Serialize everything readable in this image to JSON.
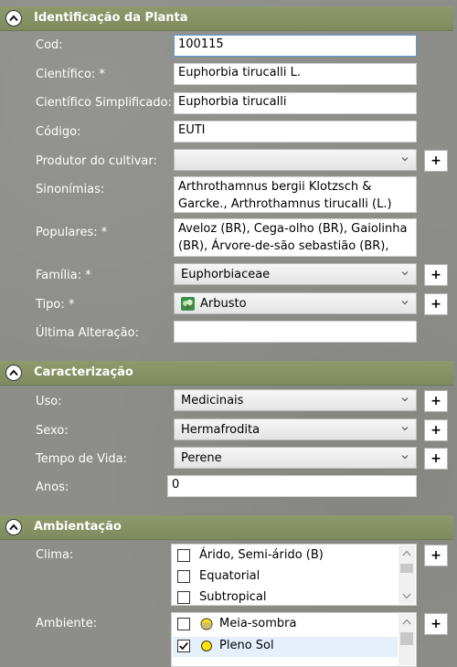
{
  "identificacao": {
    "title": "Identificação da Planta",
    "fields": {
      "cod": {
        "label": "Cod:",
        "value": "100115"
      },
      "cientifico": {
        "label": "Científico: *",
        "value": "Euphorbia tirucalli L."
      },
      "cientifico_simplificado": {
        "label": "Científico Simplificado:",
        "value": "Euphorbia tirucalli"
      },
      "codigo": {
        "label": "Código:",
        "value": "EUTI"
      },
      "produtor": {
        "label": "Produtor do cultivar:",
        "value": ""
      },
      "sinonimias": {
        "label": "Sinonímias:",
        "value": "Arthrothamnus bergii Klotzsch & Garcke., Arthrothamnus tirucalli (L.) Klotzsch &"
      },
      "populares": {
        "label": "Populares: *",
        "value": "Aveloz (BR), Cega-olho (BR), Gaiolinha (BR), Árvore-de-são sebastião (BR),"
      },
      "familia": {
        "label": "Família: *",
        "value": "Euphorbiaceae"
      },
      "tipo": {
        "label": "Tipo: *",
        "value": "Arbusto",
        "icon": "shrub-icon"
      },
      "ultima_alteracao": {
        "label": "Última Alteração:",
        "value": ""
      }
    }
  },
  "caracterizacao": {
    "title": "Caracterização",
    "fields": {
      "uso": {
        "label": "Uso:",
        "value": "Medicinais"
      },
      "sexo": {
        "label": "Sexo:",
        "value": "Hermafrodita"
      },
      "tempo_de_vida": {
        "label": "Tempo de Vida:",
        "value": "Perene"
      },
      "anos": {
        "label": "Anos:",
        "value": "0"
      }
    }
  },
  "ambientacao": {
    "title": "Ambientação",
    "clima": {
      "label": "Clima:",
      "options": [
        {
          "label": "Árido, Semi-árido (B)",
          "checked": false
        },
        {
          "label": "Equatorial",
          "checked": false
        },
        {
          "label": "Subtropical",
          "checked": false
        }
      ]
    },
    "ambiente": {
      "label": "Ambiente:",
      "options": [
        {
          "label": "Meia-sombra",
          "checked": false,
          "icon": "partial-sun-icon"
        },
        {
          "label": "Pleno Sol",
          "checked": true,
          "icon": "full-sun-icon"
        }
      ]
    }
  },
  "add_label": "+"
}
